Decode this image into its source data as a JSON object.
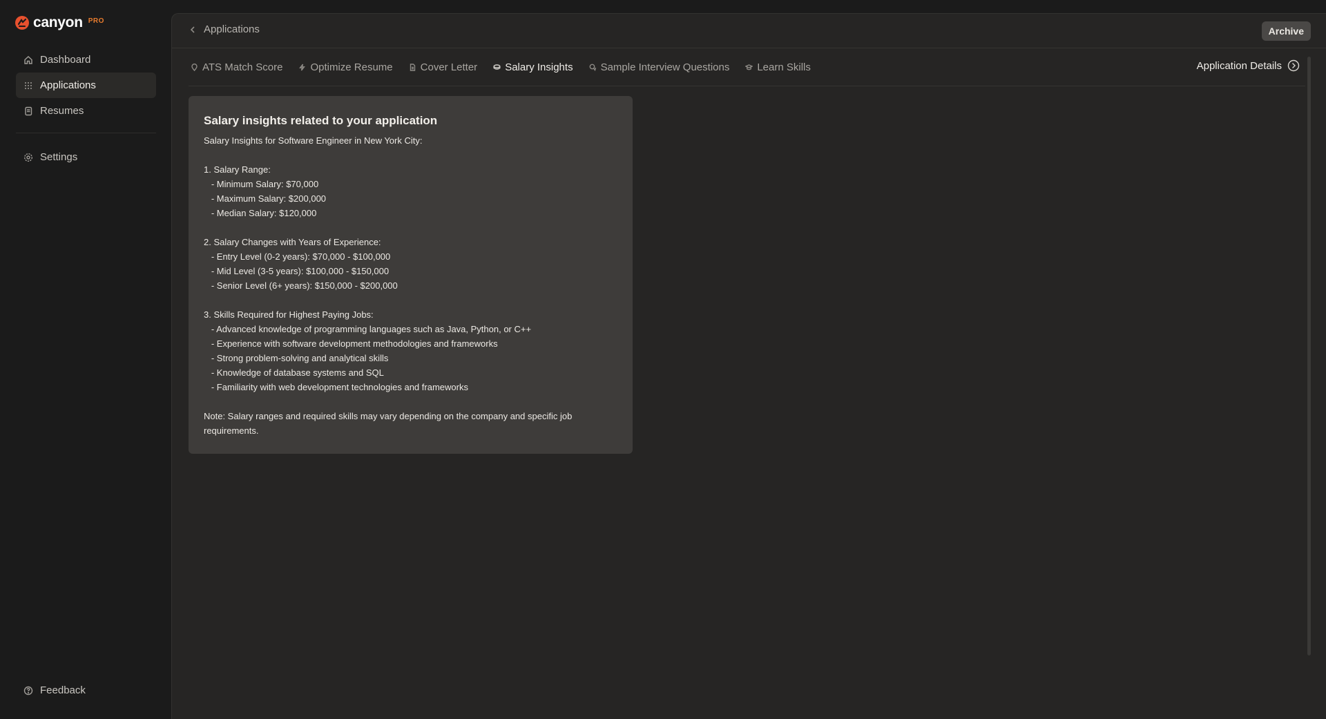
{
  "brand": {
    "name": "canyon",
    "badge": "PRO",
    "accent_color": "#e8512e",
    "badge_color": "#e87c2e"
  },
  "sidebar": {
    "items": [
      {
        "label": "Dashboard",
        "icon": "home-icon",
        "active": false
      },
      {
        "label": "Applications",
        "icon": "grid-icon",
        "active": true
      },
      {
        "label": "Resumes",
        "icon": "document-icon",
        "active": false
      },
      {
        "label": "Settings",
        "icon": "gear-icon",
        "active": false
      }
    ],
    "feedback": {
      "label": "Feedback",
      "icon": "help-icon"
    }
  },
  "header": {
    "back_label": "Applications",
    "archive_label": "Archive"
  },
  "tabs": [
    {
      "label": "ATS Match Score",
      "icon": "pin-icon",
      "active": false
    },
    {
      "label": "Optimize Resume",
      "icon": "lightning-icon",
      "active": false
    },
    {
      "label": "Cover Letter",
      "icon": "file-icon",
      "active": false
    },
    {
      "label": "Salary Insights",
      "icon": "money-icon",
      "active": true
    },
    {
      "label": "Sample Interview Questions",
      "icon": "chat-icon",
      "active": false
    },
    {
      "label": "Learn Skills",
      "icon": "graduation-cap-icon",
      "active": false
    }
  ],
  "application_details": {
    "label": "Application Details",
    "icon": "chevron-right-circle-icon"
  },
  "card": {
    "title": "Salary insights related to your application",
    "body": "Salary Insights for Software Engineer in New York City:\n\n1. Salary Range:\n   - Minimum Salary: $70,000\n   - Maximum Salary: $200,000\n   - Median Salary: $120,000\n\n2. Salary Changes with Years of Experience:\n   - Entry Level (0-2 years): $70,000 - $100,000\n   - Mid Level (3-5 years): $100,000 - $150,000\n   - Senior Level (6+ years): $150,000 - $200,000\n\n3. Skills Required for Highest Paying Jobs:\n   - Advanced knowledge of programming languages such as Java, Python, or C++\n   - Experience with software development methodologies and frameworks\n   - Strong problem-solving and analytical skills\n   - Knowledge of database systems and SQL\n   - Familiarity with web development technologies and frameworks\n\nNote: Salary ranges and required skills may vary depending on the company and specific job requirements."
  }
}
